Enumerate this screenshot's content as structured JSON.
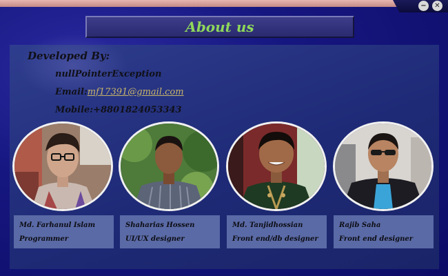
{
  "window": {
    "minimize_glyph": "−",
    "close_glyph": "✕",
    "minimize_icon": "minimize-icon",
    "close_icon": "close-icon"
  },
  "header": {
    "title": "About us"
  },
  "developer": {
    "heading": "Developed By:",
    "name": "nullPointerException",
    "email_label": "Email:",
    "email_value": "mf17391@gmail.com",
    "mobile_label": "Mobile:",
    "mobile_value": "+8801824053343"
  },
  "team": [
    {
      "name": "Md. Farhanul Islam",
      "role": "Programmer"
    },
    {
      "name": "Shaharias Hossen",
      "role": "UI/UX designer"
    },
    {
      "name": "Md. Tanjidhossian",
      "role": "Front end/db designer"
    },
    {
      "name": "Rajib Saha",
      "role": "Front end designer"
    }
  ],
  "colors": {
    "title_text": "#8fd85a",
    "panel": "#24307c",
    "card": "#5a6aa6",
    "email_link": "#c8b46a"
  }
}
